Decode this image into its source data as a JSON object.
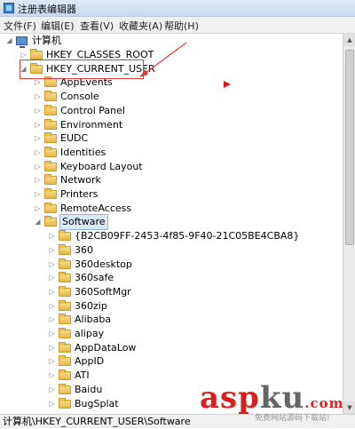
{
  "window": {
    "title": "注册表编辑器"
  },
  "menu": [
    "文件(F)",
    "编辑(E)",
    "查看(V)",
    "收藏夹(A)",
    "帮助(H)"
  ],
  "tree": {
    "root": "计算机",
    "items": [
      {
        "label": "HKEY_CLASSES_ROOT",
        "depth": 1,
        "expanded": false
      },
      {
        "label": "HKEY_CURRENT_USER",
        "depth": 1,
        "expanded": true
      },
      {
        "label": "AppEvents",
        "depth": 2,
        "expanded": false
      },
      {
        "label": "Console",
        "depth": 2,
        "expanded": false
      },
      {
        "label": "Control Panel",
        "depth": 2,
        "expanded": false
      },
      {
        "label": "Environment",
        "depth": 2,
        "expanded": false
      },
      {
        "label": "EUDC",
        "depth": 2,
        "expanded": false
      },
      {
        "label": "Identities",
        "depth": 2,
        "expanded": false
      },
      {
        "label": "Keyboard Layout",
        "depth": 2,
        "expanded": false
      },
      {
        "label": "Network",
        "depth": 2,
        "expanded": false
      },
      {
        "label": "Printers",
        "depth": 2,
        "expanded": false
      },
      {
        "label": "RemoteAccess",
        "depth": 2,
        "expanded": false
      },
      {
        "label": "Software",
        "depth": 2,
        "expanded": true,
        "selected": true
      },
      {
        "label": "{B2CB09FF-2453-4f85-9F40-21C05BE4CBA8}",
        "depth": 3,
        "expanded": false
      },
      {
        "label": "360",
        "depth": 3,
        "expanded": false
      },
      {
        "label": "360desktop",
        "depth": 3,
        "expanded": false
      },
      {
        "label": "360safe",
        "depth": 3,
        "expanded": false
      },
      {
        "label": "360SoftMgr",
        "depth": 3,
        "expanded": false
      },
      {
        "label": "360zip",
        "depth": 3,
        "expanded": false
      },
      {
        "label": "Alibaba",
        "depth": 3,
        "expanded": false
      },
      {
        "label": "alipay",
        "depth": 3,
        "expanded": false
      },
      {
        "label": "AppDataLow",
        "depth": 3,
        "expanded": false
      },
      {
        "label": "AppID",
        "depth": 3,
        "expanded": false
      },
      {
        "label": "ATI",
        "depth": 3,
        "expanded": false
      },
      {
        "label": "Baidu",
        "depth": 3,
        "expanded": false
      },
      {
        "label": "BugSplat",
        "depth": 3,
        "expanded": false
      }
    ]
  },
  "status": "计算机\\HKEY_CURRENT_USER\\Software",
  "watermark": {
    "brand_a": "asp",
    "brand_b": "ku",
    "brand_c": ".com",
    "subtitle": "免费网站源码下载站!"
  },
  "colors": {
    "annotation": "#e23a3a",
    "brand_red": "#d71f1f",
    "brand_gray": "#666666"
  }
}
